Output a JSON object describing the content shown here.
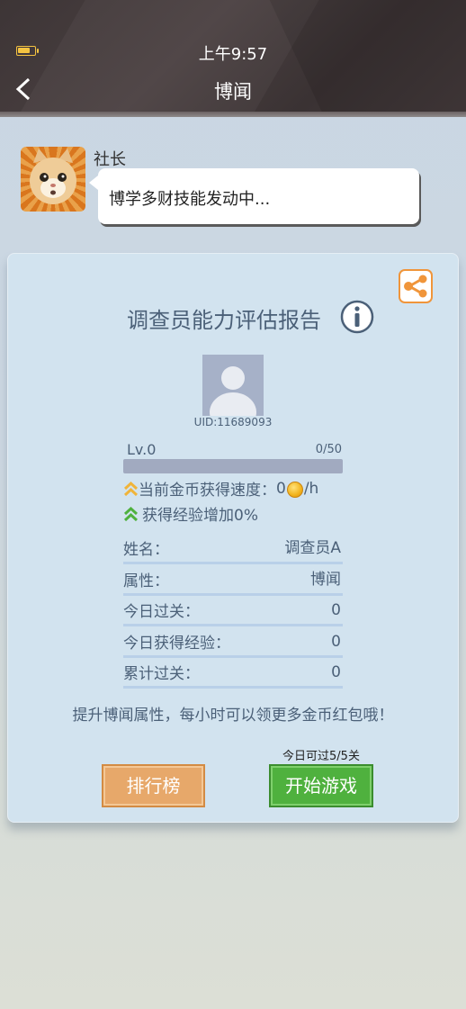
{
  "status_bar": {
    "time": "上午9:57"
  },
  "header": {
    "title": "博闻",
    "back_label": "<"
  },
  "speaker": {
    "name": "社长",
    "message": "博学多财技能发动中..."
  },
  "report": {
    "title": "调查员能力评估报告",
    "uid": "UID:11689093",
    "level": "Lv.0",
    "xp": "0/50",
    "xp_fraction": 0,
    "coin_speed_label": "当前金币获得速度：",
    "coin_speed_value": "0",
    "coin_speed_unit": "/h",
    "exp_bonus": "获得经验增加0%",
    "rows": [
      {
        "key": "姓名：",
        "value": "调查员A"
      },
      {
        "key": "属性：",
        "value": "博闻"
      },
      {
        "key": "今日过关：",
        "value": "0"
      },
      {
        "key": "今日获得经验：",
        "value": "0"
      },
      {
        "key": "累计过关：",
        "value": "0"
      }
    ],
    "tip": "提升博闻属性，每小时可以领更多金币红包哦！",
    "today_pass": "今日可过5/5关"
  },
  "buttons": {
    "rank": "排行榜",
    "start": "开始游戏"
  },
  "colors": {
    "accent_orange": "#e7a86a",
    "accent_green": "#4fb13e",
    "text_blue": "#4b6078"
  }
}
